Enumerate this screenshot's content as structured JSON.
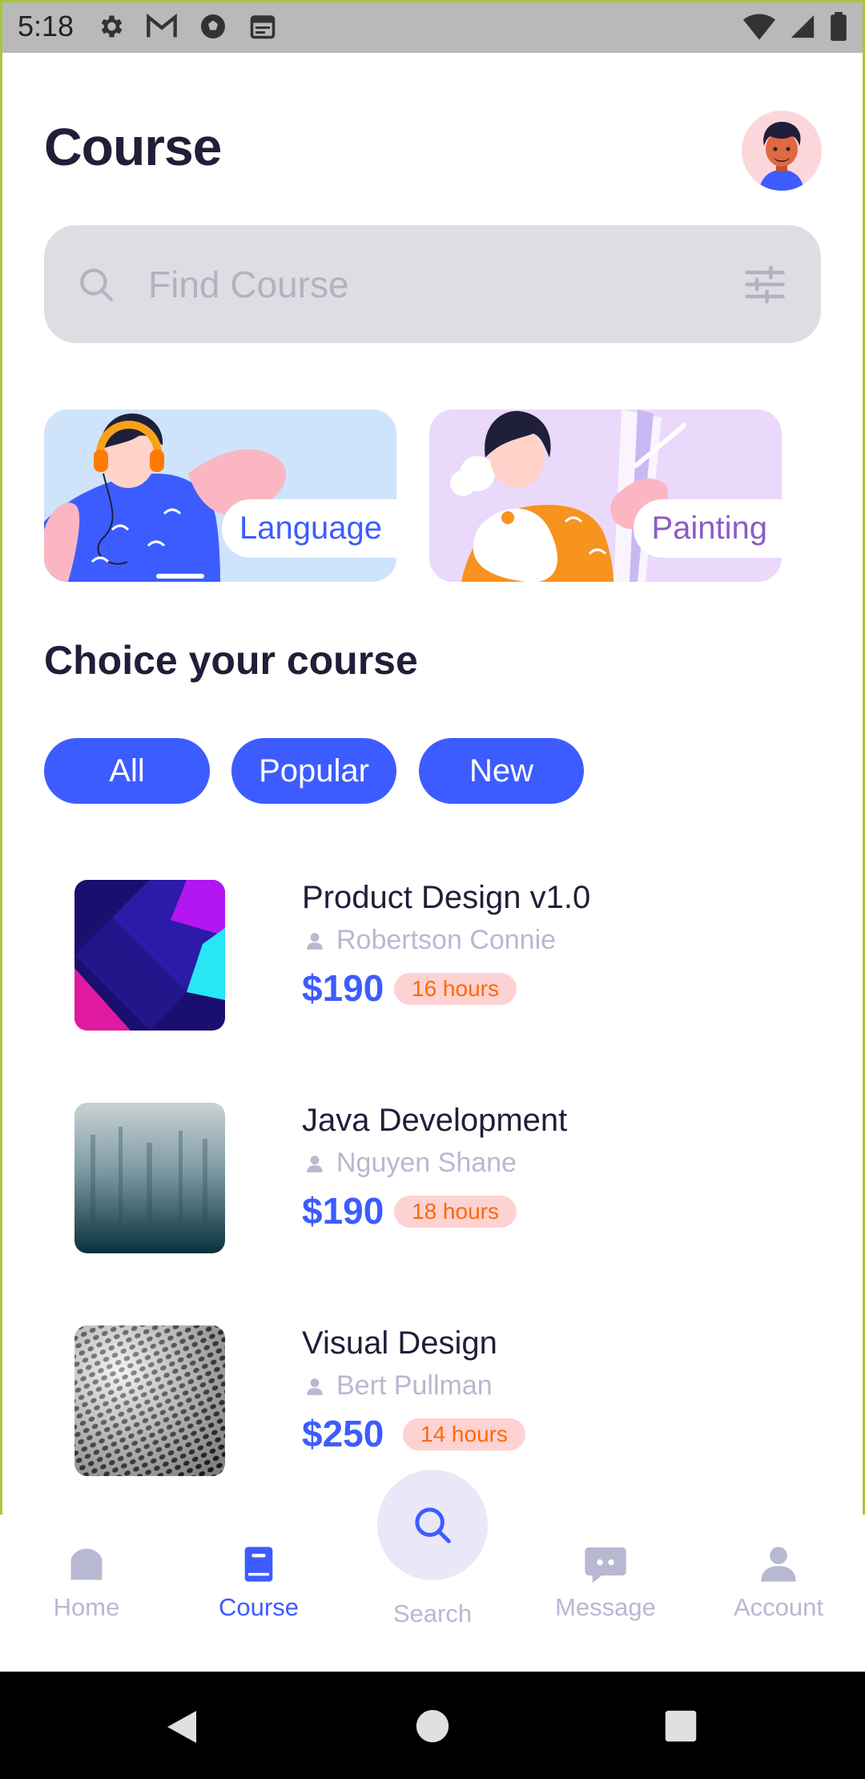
{
  "status_bar": {
    "time": "5:18"
  },
  "header": {
    "title": "Course"
  },
  "search": {
    "placeholder": "Find Course"
  },
  "categories": [
    {
      "label": "Language"
    },
    {
      "label": "Painting"
    }
  ],
  "section": {
    "title": "Choice your course"
  },
  "filters": [
    {
      "label": "All"
    },
    {
      "label": "Popular"
    },
    {
      "label": "New"
    }
  ],
  "courses": [
    {
      "title": "Product Design v1.0",
      "author": "Robertson Connie",
      "price": "$190",
      "hours": "16 hours"
    },
    {
      "title": "Java Development",
      "author": "Nguyen Shane",
      "price": "$190",
      "hours": "18 hours"
    },
    {
      "title": "Visual Design",
      "author": "Bert Pullman",
      "price": "$250",
      "hours": "14 hours"
    }
  ],
  "bottom_nav": {
    "home": "Home",
    "course": "Course",
    "search": "Search",
    "message": "Message",
    "account": "Account",
    "active": "Course"
  },
  "colors": {
    "accent": "#3d5cff",
    "hours_badge_bg": "#fdd2d2",
    "hours_badge_text": "#ff6905",
    "muted": "#b8b8d2"
  }
}
